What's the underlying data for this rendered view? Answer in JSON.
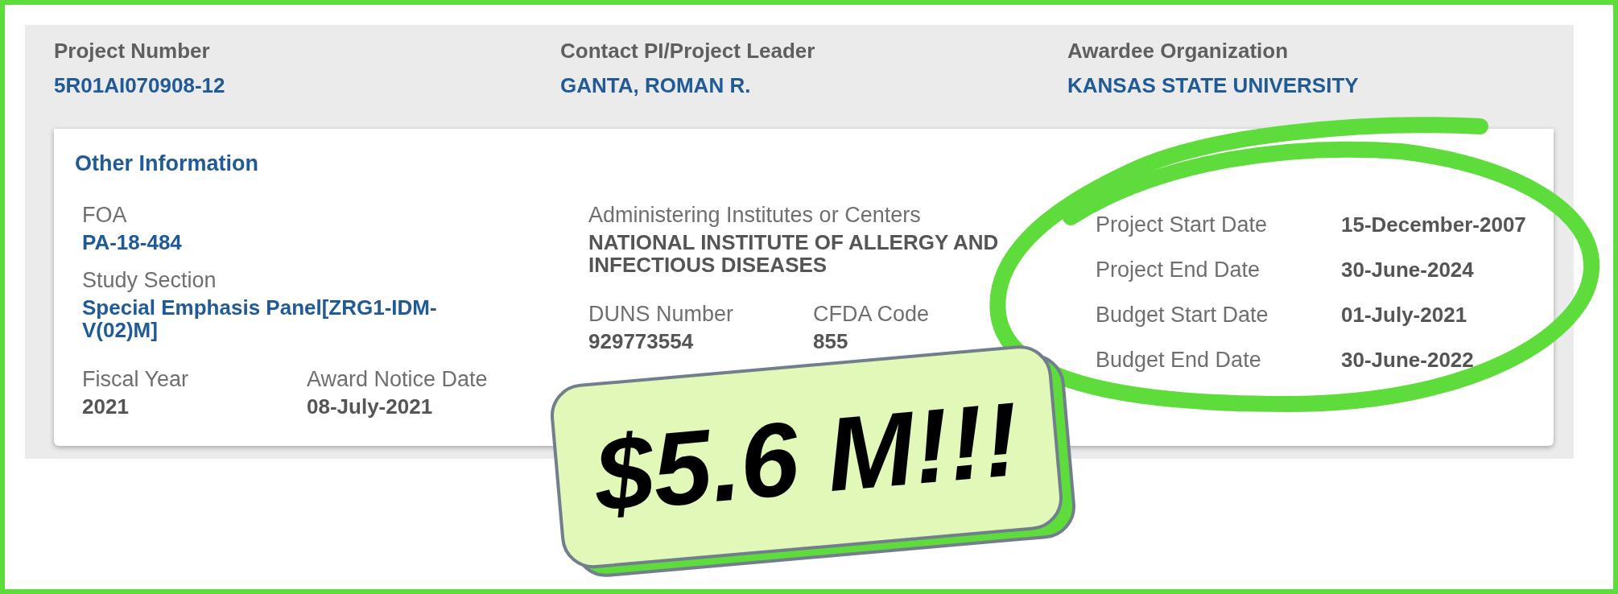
{
  "header": {
    "fields": [
      {
        "label": "Project Number",
        "value": "5R01AI070908-12"
      },
      {
        "label": "Contact PI/Project Leader",
        "value": "GANTA, ROMAN R."
      },
      {
        "label": "Awardee Organization",
        "value": "KANSAS STATE UNIVERSITY"
      }
    ]
  },
  "other_information": {
    "title": "Other Information",
    "columns": [
      {
        "rows": [
          [
            {
              "label": "FOA",
              "value": "PA-18-484",
              "kind": "link"
            }
          ],
          [
            {
              "label": "Study Section",
              "value": "Special Emphasis Panel[ZRG1-IDM-V(02)M]",
              "kind": "link"
            }
          ],
          [
            {
              "label": "Fiscal Year",
              "value": "2021",
              "kind": "text"
            },
            {
              "label": "Award Notice Date",
              "value": "08-July-2021",
              "kind": "text"
            }
          ]
        ]
      },
      {
        "rows": [
          [
            {
              "label": "Administering Institutes or Centers",
              "value": "NATIONAL INSTITUTE OF ALLERGY AND INFECTIOUS DISEASES",
              "kind": "text"
            }
          ],
          [
            {
              "label": "DUNS Number",
              "value": "929773554",
              "kind": "text"
            },
            {
              "label": "CFDA Code",
              "value": "855",
              "kind": "text"
            }
          ]
        ]
      }
    ],
    "dates": [
      {
        "label": "Project Start Date",
        "value": "15-December-2007"
      },
      {
        "label": "Project End Date",
        "value": "30-June-2024"
      },
      {
        "label": "Budget Start Date",
        "value": "01-July-2021"
      },
      {
        "label": "Budget End Date",
        "value": "30-June-2022"
      }
    ]
  },
  "sticker": {
    "text": "$5.6 M!!!"
  }
}
